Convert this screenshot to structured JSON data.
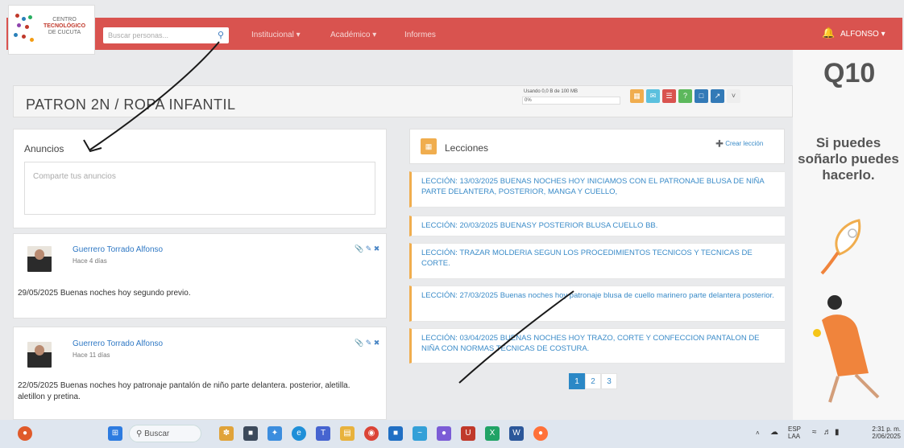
{
  "nav": {
    "logo_line1": "CENTRO",
    "logo_line2": "TECNOLÓGICO",
    "logo_line3": "DE CUCUTA",
    "search_placeholder": "Buscar personas...",
    "links": [
      "Institucional ▾",
      "Académico ▾",
      "Informes"
    ],
    "user": "ALFONSO ▾",
    "accent": "#d9534f"
  },
  "page": {
    "title": "PATRON 2N / ROPA INFANTIL",
    "usage": "Usando 0,0 B de 100 MB",
    "usage_percent": "0%",
    "usage_fraction": 0.0,
    "tool_colors": [
      "#f0ad4e",
      "#5bc0de",
      "#d9534f",
      "#5cb85c",
      "#337ab7",
      "#337ab7",
      "#eeeeee"
    ]
  },
  "announcements": {
    "title": "Anuncios",
    "placeholder": "Comparte tus anuncios",
    "posts": [
      {
        "author": "Guerrero Torrado Alfonso",
        "time": "Hace 4 días",
        "text": "29/05/2025 Buenas noches hoy segundo previo."
      },
      {
        "author": "Guerrero Torrado Alfonso",
        "time": "Hace 11 días",
        "text": "22/05/2025 Buenas noches hoy patronaje pantalón de niño parte delantera. posterior, aletilla. aletillon y pretina."
      }
    ]
  },
  "lessons": {
    "title": "Lecciones",
    "create": "Crear lección",
    "items": [
      "LECCIÓN: 13/03/2025 BUENAS NOCHES HOY INICIAMOS CON EL PATRONAJE BLUSA DE NIÑA PARTE DELANTERA, POSTERIOR, MANGA Y CUELLO,",
      "LECCIÓN: 20/03/2025 BUENASY POSTERIOR BLUSA CUELLO BB.",
      "LECCIÓN: TRAZAR MOLDERIA SEGUN LOS PROCEDIMIENTOS TECNICOS Y TECNICAS DE CORTE.",
      "LECCIÓN: 27/03/2025 Buenas noches hoy patronaje blusa de cuello marinero parte delantera posterior.",
      "LECCIÓN: 03/04/2025 BUENAS NOCHES HOY TRAZO, CORTE Y CONFECCION PANTALON DE NIÑA CON NORMAS TECNICAS DE COSTURA."
    ],
    "pages": [
      "1",
      "2",
      "3"
    ]
  },
  "ad": {
    "brand": "Q10",
    "slogan": "Si puedes soñarlo puedes hacerlo."
  },
  "taskbar": {
    "search": "Buscar",
    "lang": "ESP",
    "lang2": "LAA",
    "time": "2:31 p. m.",
    "date": "2/06/2025",
    "app_colors": [
      "#3c8dde",
      "#e8b23d",
      "#3778c7",
      "#45a3e0",
      "#2d7be0",
      "#e8b23d",
      "#e05a2a",
      "#1f7bdc",
      "#33a0d8",
      "#7b5cd6",
      "#c0392b",
      "#21a366",
      "#2b579a",
      "#ff7139"
    ]
  }
}
